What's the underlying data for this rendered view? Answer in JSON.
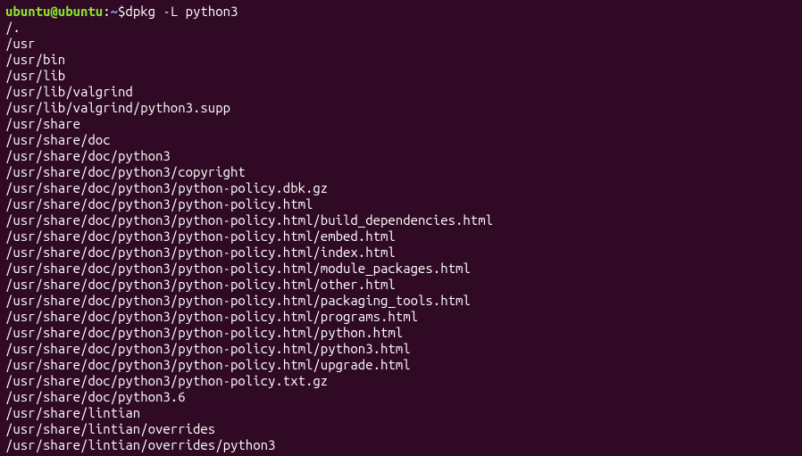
{
  "prompt": {
    "user_host": "ubuntu@ubuntu",
    "colon": ":",
    "path": "~",
    "dollar": "$",
    "command": " dpkg -L python3"
  },
  "output": [
    "/.",
    "/usr",
    "/usr/bin",
    "/usr/lib",
    "/usr/lib/valgrind",
    "/usr/lib/valgrind/python3.supp",
    "/usr/share",
    "/usr/share/doc",
    "/usr/share/doc/python3",
    "/usr/share/doc/python3/copyright",
    "/usr/share/doc/python3/python-policy.dbk.gz",
    "/usr/share/doc/python3/python-policy.html",
    "/usr/share/doc/python3/python-policy.html/build_dependencies.html",
    "/usr/share/doc/python3/python-policy.html/embed.html",
    "/usr/share/doc/python3/python-policy.html/index.html",
    "/usr/share/doc/python3/python-policy.html/module_packages.html",
    "/usr/share/doc/python3/python-policy.html/other.html",
    "/usr/share/doc/python3/python-policy.html/packaging_tools.html",
    "/usr/share/doc/python3/python-policy.html/programs.html",
    "/usr/share/doc/python3/python-policy.html/python.html",
    "/usr/share/doc/python3/python-policy.html/python3.html",
    "/usr/share/doc/python3/python-policy.html/upgrade.html",
    "/usr/share/doc/python3/python-policy.txt.gz",
    "/usr/share/doc/python3.6",
    "/usr/share/lintian",
    "/usr/share/lintian/overrides",
    "/usr/share/lintian/overrides/python3"
  ]
}
